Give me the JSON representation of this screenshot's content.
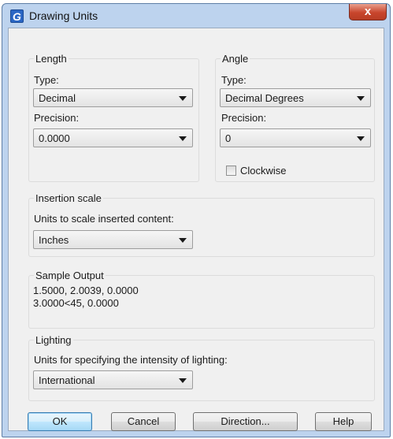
{
  "window": {
    "title": "Drawing Units",
    "app_icon": "G",
    "close_label": "x"
  },
  "length": {
    "legend": "Length",
    "type_label": "Type:",
    "type_value": "Decimal",
    "precision_label": "Precision:",
    "precision_value": "0.0000"
  },
  "angle": {
    "legend": "Angle",
    "type_label": "Type:",
    "type_value": "Decimal Degrees",
    "precision_label": "Precision:",
    "precision_value": "0",
    "clockwise_label": "Clockwise",
    "clockwise_checked": false
  },
  "insertion": {
    "legend": "Insertion scale",
    "label": "Units to scale inserted content:",
    "value": "Inches"
  },
  "sample": {
    "legend": "Sample Output",
    "line1": "1.5000, 2.0039, 0.0000",
    "line2": "3.0000<45, 0.0000"
  },
  "lighting": {
    "legend": "Lighting",
    "label": "Units for specifying the intensity of lighting:",
    "value": "International"
  },
  "buttons": {
    "ok": "OK",
    "cancel": "Cancel",
    "direction": "Direction...",
    "help": "Help"
  }
}
